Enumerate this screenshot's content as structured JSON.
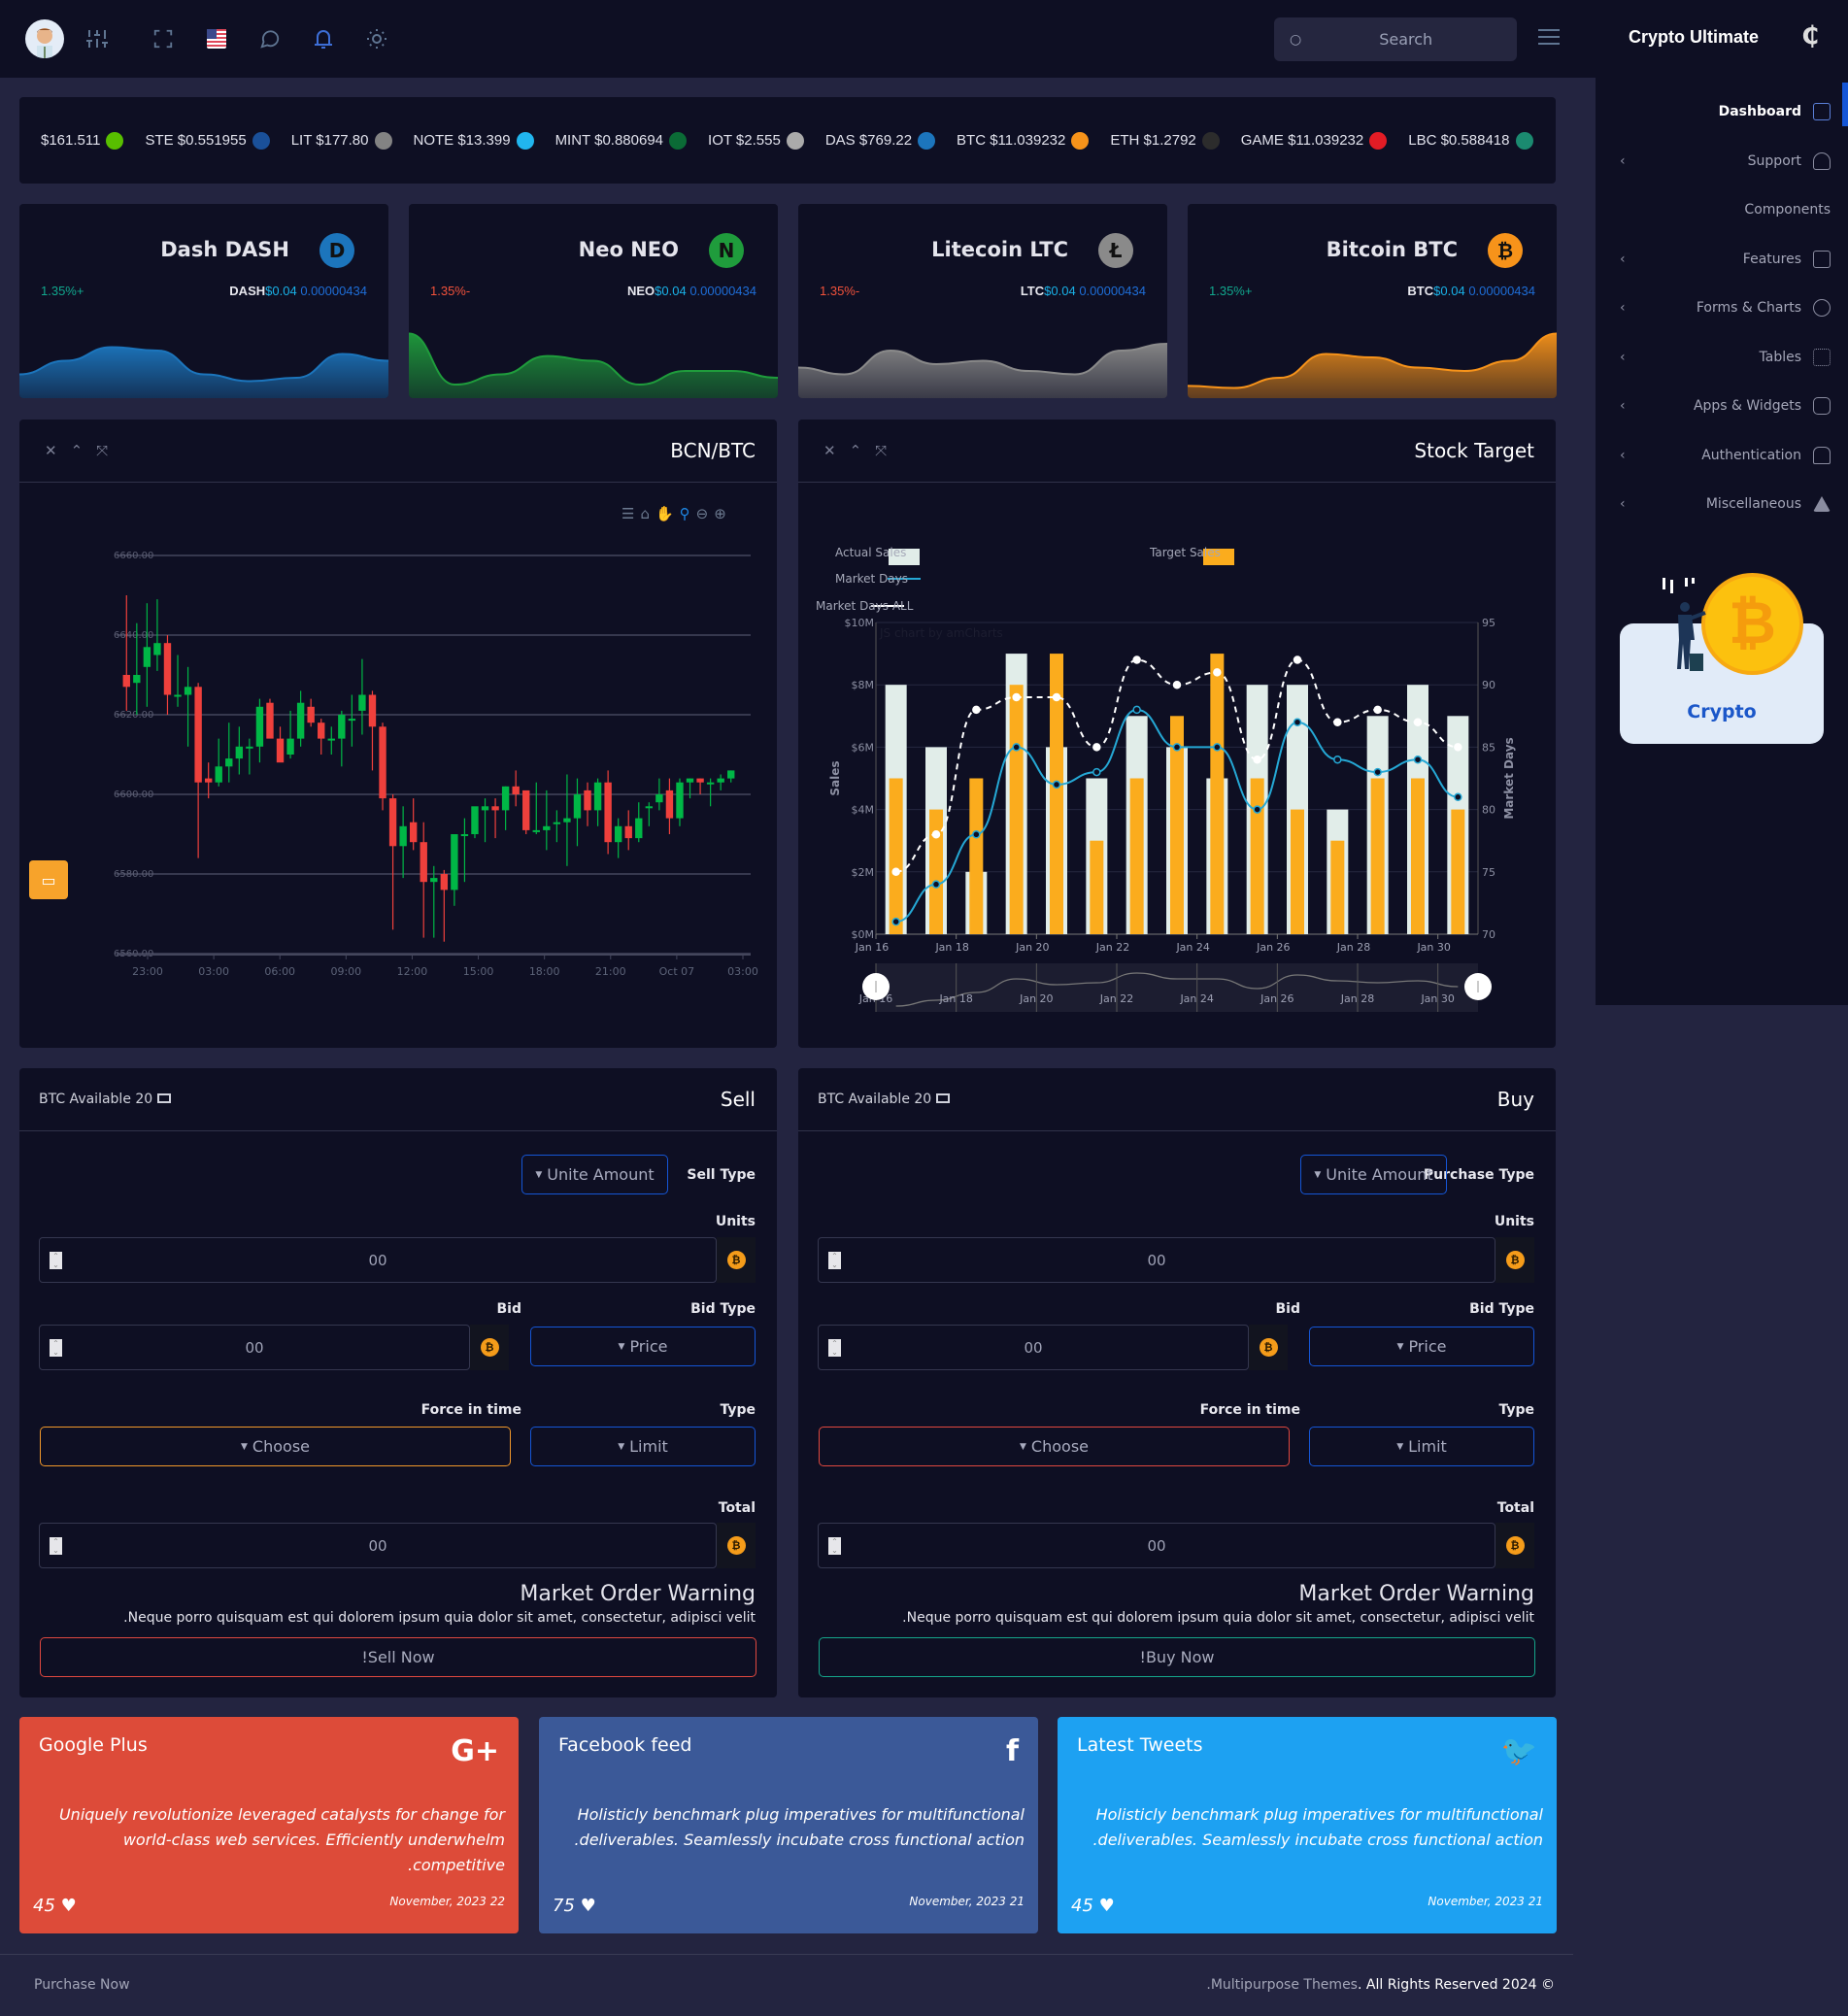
{
  "header": {
    "icons": [
      "avatar",
      "sliders-icon",
      "fullscreen-icon",
      "flag-us-icon",
      "chat-icon",
      "bell-icon",
      "sun-icon"
    ],
    "search": {
      "placeholder": "Search"
    },
    "brand": "Crypto Ultimate"
  },
  "sidebar": {
    "items": [
      {
        "label": "Dashboard",
        "icon": "home-icon",
        "active": true,
        "chevron": false
      },
      {
        "label": "Support",
        "icon": "headphones-icon",
        "chevron": true
      },
      {
        "label": "Components",
        "icon": "",
        "chevron": false
      },
      {
        "label": "Features",
        "icon": "edit-icon",
        "chevron": true
      },
      {
        "label": "Forms & Charts",
        "icon": "pie-chart-icon",
        "chevron": true
      },
      {
        "label": "Tables",
        "icon": "grid-icon",
        "chevron": true
      },
      {
        "label": "Apps & Widgets",
        "icon": "database-icon",
        "chevron": true
      },
      {
        "label": "Authentication",
        "icon": "lock-icon",
        "chevron": true
      },
      {
        "label": "Miscellaneous",
        "icon": "alert-triangle-icon",
        "chevron": true
      }
    ],
    "promo_label": "Crypto"
  },
  "ticker": [
    {
      "text": "$161.511",
      "icon": "neo",
      "color": "#58bf00"
    },
    {
      "text": "STE $0.551955",
      "icon": "steem",
      "color": "#1a5099"
    },
    {
      "text": "LIT $177.80",
      "icon": "litecoin",
      "color": "#838383"
    },
    {
      "text": "NOTE $13.399",
      "icon": "dnote",
      "color": "#21b6ef"
    },
    {
      "text": "MINT $0.880694",
      "icon": "mint",
      "color": "#0b6b36"
    },
    {
      "text": "IOT $2.555",
      "icon": "iota",
      "color": "#aaaaaa"
    },
    {
      "text": "DAS $769.22",
      "icon": "dash",
      "color": "#1c75bc"
    },
    {
      "text": "BTC $11.039232",
      "icon": "bitcoin",
      "color": "#f7931a"
    },
    {
      "text": "ETH $1.2792",
      "icon": "ethereum",
      "color": "#2c2c2c"
    },
    {
      "text": "GAME $11.039232",
      "icon": "gamecredits",
      "color": "#e31c25"
    },
    {
      "text": "LBC $0.588418",
      "icon": "lbry",
      "color": "#1b8a70"
    }
  ],
  "coin_cards": [
    {
      "name": "Dash DASH",
      "symbol": "DASH",
      "change": "1.35%+",
      "change_dir": "up",
      "price": "$0.04",
      "btc": "0.00000434",
      "color": "#1c75bc",
      "glyph": "D",
      "spark": [
        0.35,
        0.55,
        0.75,
        0.7,
        0.35,
        0.25,
        0.3,
        0.65,
        0.55
      ]
    },
    {
      "name": "Neo NEO",
      "symbol": "NEO",
      "change": "1.35%-",
      "change_dir": "down",
      "price": "$0.04",
      "btc": "0.00000434",
      "color": "#1f9c3c",
      "glyph": "N",
      "spark": [
        0.95,
        0.2,
        0.35,
        0.62,
        0.55,
        0.2,
        0.4,
        0.4,
        0.3
      ]
    },
    {
      "name": "Litecoin LTC",
      "symbol": "LTC",
      "change": "1.35%-",
      "change_dir": "down",
      "price": "$0.04",
      "btc": "0.00000434",
      "color": "#8a8a8a",
      "glyph": "Ł",
      "spark": [
        0.45,
        0.35,
        0.7,
        0.5,
        0.55,
        0.4,
        0.35,
        0.7,
        0.8
      ]
    },
    {
      "name": "Bitcoin BTC",
      "symbol": "BTC",
      "change": "1.35%+",
      "change_dir": "up",
      "price": "$0.04",
      "btc": "0.00000434",
      "color": "#f7931a",
      "glyph": "₿",
      "spark": [
        0.18,
        0.15,
        0.3,
        0.65,
        0.6,
        0.45,
        0.4,
        0.55,
        0.95
      ]
    }
  ],
  "bcn_panel": {
    "title": "BCN/BTC",
    "toolbar": [
      "menu-icon",
      "home-icon",
      "pan-icon",
      "zoom-icon",
      "zoom-out-icon",
      "zoom-in-icon"
    ]
  },
  "stock_panel": {
    "title": "Stock Target"
  },
  "chart_data": [
    {
      "type": "candlestick",
      "title": "BCN/BTC",
      "ylim": [
        6560,
        6660
      ],
      "yticks": [
        "6660.00",
        "6640.00",
        "6620.00",
        "6600.00",
        "6580.00",
        "6560.00"
      ],
      "xticks": [
        "23:00",
        "03:00",
        "06:00",
        "09:00",
        "12:00",
        "15:00",
        "18:00",
        "21:00",
        "Oct 07",
        "03:00"
      ],
      "grid": true,
      "candles": [
        [
          6630,
          6650,
          6621,
          6627
        ],
        [
          6628,
          6643,
          6620,
          6630
        ],
        [
          6632,
          6648,
          6622,
          6637
        ],
        [
          6635,
          6649,
          6631,
          6638
        ],
        [
          6638,
          6640,
          6620,
          6625
        ],
        [
          6625,
          6635,
          6622,
          6625
        ],
        [
          6625,
          6632,
          6612,
          6627
        ],
        [
          6627,
          6628,
          6584,
          6603
        ],
        [
          6604,
          6608,
          6599,
          6603
        ],
        [
          6603,
          6614,
          6602,
          6607
        ],
        [
          6607,
          6618,
          6603,
          6609
        ],
        [
          6609,
          6617,
          6605,
          6612
        ],
        [
          6612,
          6614,
          6605,
          6612
        ],
        [
          6612,
          6624,
          6608,
          6622
        ],
        [
          6623,
          6624,
          6615,
          6614
        ],
        [
          6614,
          6617,
          6609,
          6608
        ],
        [
          6610,
          6621,
          6609,
          6614
        ],
        [
          6614,
          6626,
          6612,
          6623
        ],
        [
          6622,
          6624,
          6617,
          6618
        ],
        [
          6618,
          6619,
          6610,
          6614
        ],
        [
          6614,
          6617,
          6610,
          6614
        ],
        [
          6614,
          6621,
          6607,
          6620
        ],
        [
          6619,
          6625,
          6612,
          6619
        ],
        [
          6621,
          6634,
          6615,
          6625
        ],
        [
          6625,
          6626,
          6606,
          6617
        ],
        [
          6617,
          6618,
          6596,
          6599
        ],
        [
          6599,
          6600,
          6566,
          6587
        ],
        [
          6587,
          6597,
          6579,
          6592
        ],
        [
          6593,
          6599,
          6586,
          6588
        ],
        [
          6588,
          6593,
          6564,
          6578
        ],
        [
          6578,
          6582,
          6564,
          6579
        ],
        [
          6580,
          6581,
          6563,
          6576
        ],
        [
          6576,
          6590,
          6572,
          6590
        ],
        [
          6590,
          6594,
          6578,
          6590
        ],
        [
          6590,
          6596,
          6589,
          6597
        ],
        [
          6596,
          6599,
          6588,
          6597
        ],
        [
          6597,
          6599,
          6589,
          6596
        ],
        [
          6596,
          6602,
          6591,
          6602
        ],
        [
          6602,
          6606,
          6597,
          6600
        ],
        [
          6601,
          6600,
          6590,
          6591
        ],
        [
          6591,
          6603,
          6590,
          6591
        ],
        [
          6591,
          6601,
          6586,
          6592
        ],
        [
          6593,
          6596,
          6588,
          6593
        ],
        [
          6593,
          6605,
          6582,
          6594
        ],
        [
          6594,
          6604,
          6587,
          6600
        ],
        [
          6601,
          6603,
          6592,
          6596
        ],
        [
          6596,
          6604,
          6592,
          6603
        ],
        [
          6603,
          6606,
          6585,
          6588
        ],
        [
          6588,
          6594,
          6584,
          6592
        ],
        [
          6592,
          6596,
          6586,
          6589
        ],
        [
          6589,
          6598,
          6588,
          6594
        ],
        [
          6597,
          6598,
          6592,
          6597
        ],
        [
          6598,
          6604,
          6596,
          6600
        ],
        [
          6601,
          6604,
          6590,
          6594
        ],
        [
          6594,
          6604,
          6592,
          6603
        ],
        [
          6603,
          6604,
          6599,
          6604
        ],
        [
          6604,
          6604,
          6600,
          6603
        ],
        [
          6603,
          6604,
          6597,
          6603
        ],
        [
          6603,
          6605,
          6601,
          6604
        ],
        [
          6604,
          6606,
          6603,
          6606
        ]
      ]
    },
    {
      "type": "bar+line",
      "title": "Stock Target",
      "categories": [
        "Jan 16",
        "Jan 17",
        "Jan 18",
        "Jan 19",
        "Jan 20",
        "Jan 21",
        "Jan 22",
        "Jan 23",
        "Jan 24",
        "Jan 25",
        "Jan 26",
        "Jan 27",
        "Jan 28",
        "Jan 29",
        "Jan 30"
      ],
      "xticks": [
        "Jan 16",
        "Jan 18",
        "Jan 20",
        "Jan 22",
        "Jan 24",
        "Jan 26",
        "Jan 28",
        "Jan 30"
      ],
      "ylabel": "Sales",
      "y2label": "Market Days",
      "ylim": [
        0,
        10
      ],
      "yticks": [
        "$0M",
        "$2M",
        "$4M",
        "$6M",
        "$8M",
        "$10M"
      ],
      "y2lim": [
        70,
        95
      ],
      "y2ticks": [
        "70",
        "75",
        "80",
        "85",
        "90",
        "95"
      ],
      "legend": [
        "Actual Sales",
        "Target Sales",
        "Market Days",
        "Market Days ALL"
      ],
      "legend_position": "top",
      "watermark": "JS chart by amCharts",
      "series": [
        {
          "name": "Actual Sales",
          "unit": "$M",
          "color": "#e1ede9",
          "values": [
            8,
            6,
            2,
            9,
            6,
            5,
            7,
            6,
            5,
            8,
            8,
            4,
            7,
            8,
            7
          ]
        },
        {
          "name": "Target Sales",
          "unit": "$M",
          "color": "#fbac1d",
          "values": [
            5,
            4,
            5,
            8,
            9,
            3,
            5,
            7,
            9,
            5,
            4,
            3,
            5,
            5,
            4
          ]
        },
        {
          "name": "Market Days",
          "color": "#25a8d5",
          "values": [
            71,
            74,
            78,
            85,
            82,
            83,
            88,
            85,
            85,
            80,
            87,
            84,
            83,
            84,
            81
          ]
        },
        {
          "name": "Market Days ALL",
          "color": "#ffffff",
          "dashed": true,
          "values": [
            75,
            78,
            88,
            89,
            89,
            85,
            92,
            90,
            91,
            84,
            92,
            87,
            88,
            87,
            85
          ]
        }
      ]
    }
  ],
  "sell_form": {
    "available": "BTC Available 20",
    "title": "Sell",
    "type_label": "Sell Type",
    "type_value": "Unite Amount",
    "units_label": "Units",
    "units_value": "00",
    "bid_label": "Bid",
    "bid_value": "00",
    "bid_type_label": "Bid Type",
    "bid_type_value": "Price",
    "force_label": "Force in time",
    "force_value": "Choose",
    "type2_label": "Type",
    "type2_value": "Limit",
    "total_label": "Total",
    "total_value": "00",
    "warning_title": "Market Order Warning",
    "warning_text": ".Neque porro quisquam est qui dolorem ipsum quia dolor sit amet, consectetur, adipisci velit",
    "action": "!Sell Now",
    "action_color": "#e0483f",
    "force_color": "#f1982a"
  },
  "buy_form": {
    "available": "BTC Available 20",
    "title": "Buy",
    "type_label": "Purchase Type",
    "type_value": "Unite Amount",
    "units_label": "Units",
    "units_value": "00",
    "bid_label": "Bid",
    "bid_value": "00",
    "bid_type_label": "Bid Type",
    "bid_type_value": "Price",
    "force_label": "Force in time",
    "force_value": "Choose",
    "type2_label": "Type",
    "type2_value": "Limit",
    "total_label": "Total",
    "total_value": "00",
    "warning_title": "Market Order Warning",
    "warning_text": ".Neque porro quisquam est qui dolorem ipsum quia dolor sit amet, consectetur, adipisci velit",
    "action": "!Buy Now",
    "action_color": "#15a68a",
    "force_color": "#e0483f"
  },
  "social": [
    {
      "title": "Google Plus",
      "icon": "G+",
      "text": "Uniquely revolutionize leveraged catalysts for change for world-class web services. Efficiently underwhelm .competitive",
      "likes": "45",
      "date": "November, 2023 22",
      "color": "#dd4b39"
    },
    {
      "title": "Facebook feed",
      "icon": "f",
      "text": "Holisticly benchmark plug imperatives for multifunctional .deliverables. Seamlessly incubate cross functional action",
      "likes": "75",
      "date": "November, 2023 21",
      "color": "#3b5998"
    },
    {
      "title": "Latest Tweets",
      "icon": "🐦",
      "text": "Holisticly benchmark plug imperatives for multifunctional .deliverables. Seamlessly incubate cross functional action",
      "likes": "45",
      "date": "November, 2023 21",
      "color": "#1da1f2"
    }
  ],
  "footer": {
    "left": "Purchase Now",
    "right_prefix": ".Multipurpose Themes",
    "right_suffix": ". All Rights Reserved 2024 ©"
  }
}
